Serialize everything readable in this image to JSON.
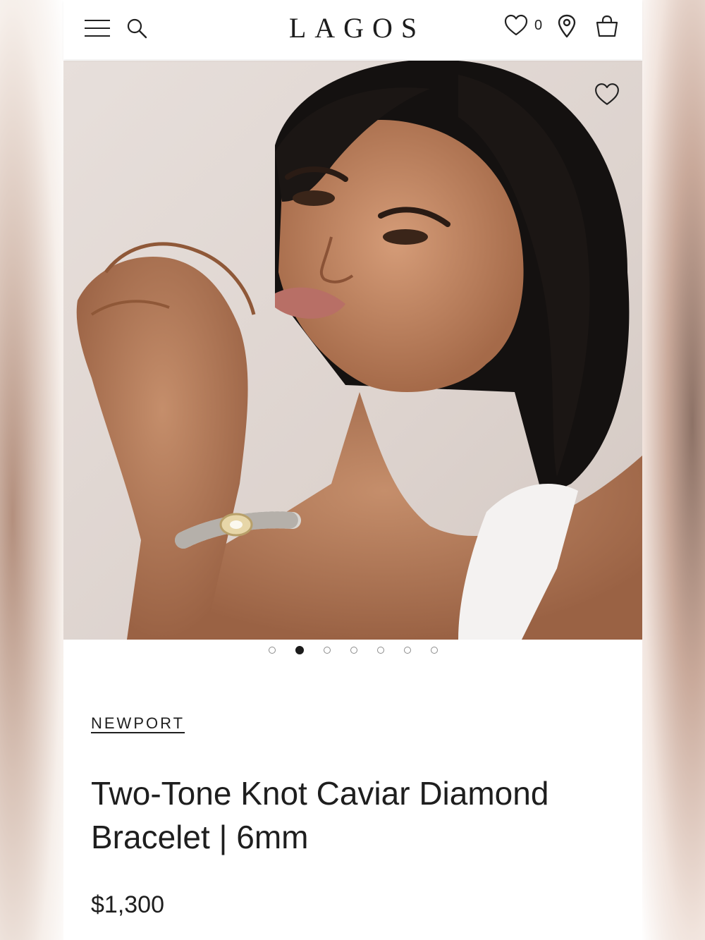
{
  "header": {
    "brand": "LAGOS",
    "wishlist_count": "0",
    "icons": [
      "menu-icon",
      "search-icon",
      "heart-icon",
      "location-pin-icon",
      "shopping-bag-icon"
    ]
  },
  "product": {
    "collection": "NEWPORT",
    "title": "Two-Tone Knot Caviar Diamond Bracelet | 6mm",
    "price": "$1,300"
  },
  "gallery": {
    "image_count": 7,
    "active_index": 1
  },
  "colors": {
    "text": "#1e1e1e",
    "dot_active": "#1b1b1b",
    "dot_inactive": "#8c8c8c"
  }
}
